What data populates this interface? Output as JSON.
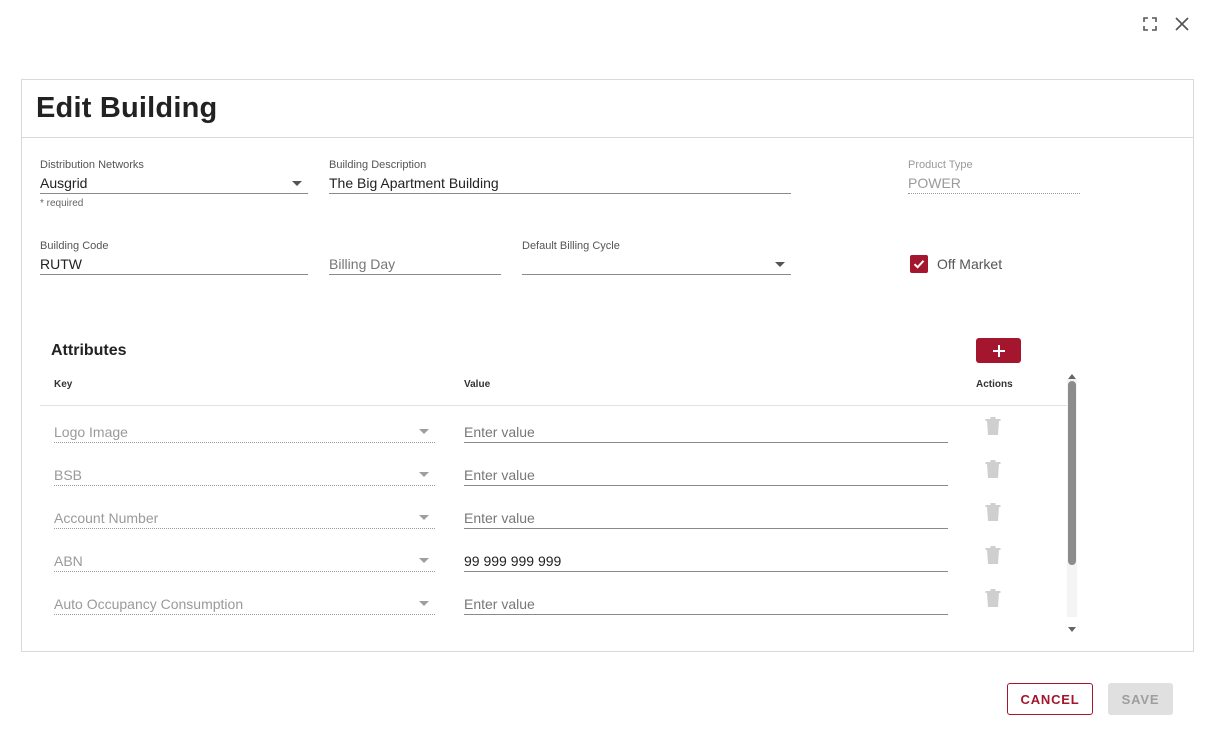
{
  "dialog": {
    "title": "Edit Building"
  },
  "form": {
    "distribution_networks": {
      "label": "Distribution Networks",
      "value": "Ausgrid",
      "hint": "* required"
    },
    "building_description": {
      "label": "Building Description",
      "value": "The Big Apartment Building"
    },
    "product_type": {
      "label": "Product Type",
      "value": "POWER"
    },
    "building_code": {
      "label": "Building Code",
      "value": "RUTW"
    },
    "billing_day": {
      "label": "",
      "placeholder": "Billing Day"
    },
    "default_billing_cycle": {
      "label": "Default Billing Cycle",
      "value": ""
    },
    "off_market": {
      "label": "Off Market",
      "checked": true
    }
  },
  "attributes": {
    "title": "Attributes",
    "columns": {
      "key": "Key",
      "value": "Value",
      "actions": "Actions"
    },
    "rows": [
      {
        "key": "Logo Image",
        "value": "",
        "placeholder": "Enter value"
      },
      {
        "key": "BSB",
        "value": "",
        "placeholder": "Enter value"
      },
      {
        "key": "Account Number",
        "value": "",
        "placeholder": "Enter value"
      },
      {
        "key": "ABN",
        "value": "99 999 999 999",
        "placeholder": "Enter value"
      },
      {
        "key": "Auto Occupancy Consumption",
        "value": "",
        "placeholder": "Enter value"
      }
    ]
  },
  "footer": {
    "cancel_label": "CANCEL",
    "save_label": "SAVE",
    "save_disabled": true
  },
  "icons": {
    "fullscreen": "fullscreen-icon",
    "close": "close-icon",
    "add": "plus-icon",
    "delete": "trash-icon",
    "check": "check-icon"
  },
  "colors": {
    "accent": "#a3162e",
    "disabled_bg": "#e0e0e0",
    "disabled_text": "#9e9e9e"
  }
}
